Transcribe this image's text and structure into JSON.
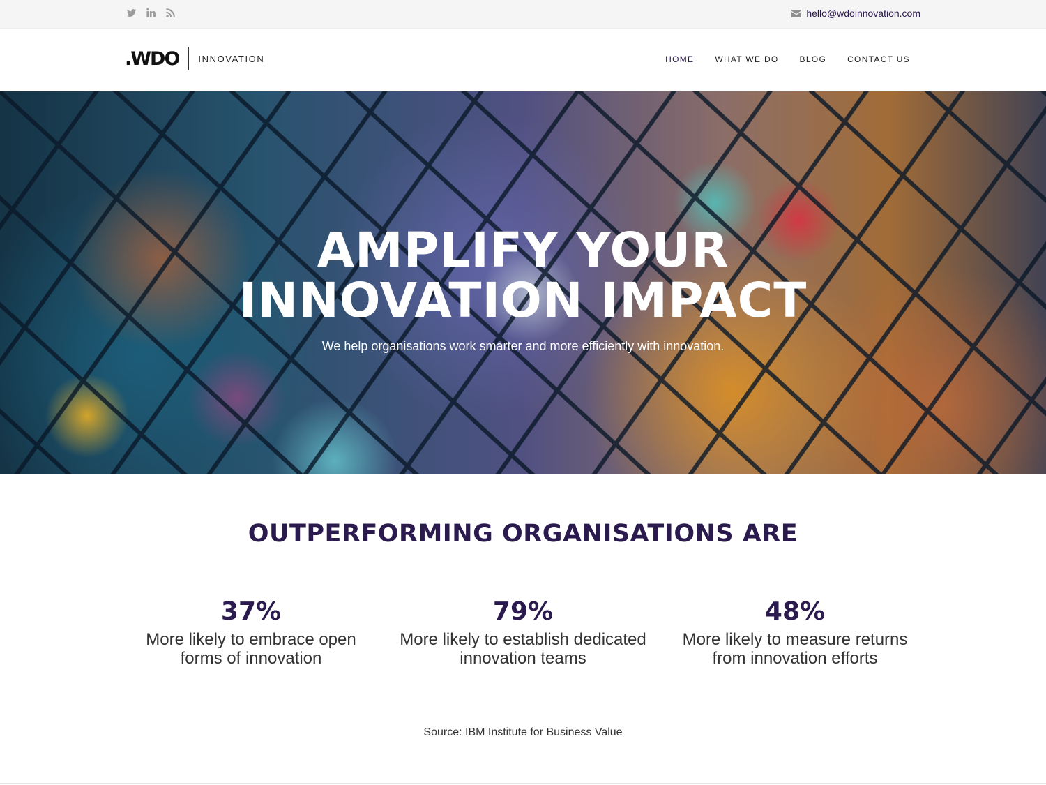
{
  "topbar": {
    "social": [
      {
        "name": "twitter-icon"
      },
      {
        "name": "linkedin-icon"
      },
      {
        "name": "rss-icon"
      }
    ],
    "email": "hello@wdoinnovation.com"
  },
  "header": {
    "logo_mark": ".WDO",
    "logo_sub": "INNOVATION",
    "nav": [
      {
        "label": "HOME",
        "active": true
      },
      {
        "label": "WHAT WE DO",
        "active": false
      },
      {
        "label": "BLOG",
        "active": false
      },
      {
        "label": "CONTACT US",
        "active": false
      }
    ]
  },
  "hero": {
    "title_line1": "AMPLIFY YOUR",
    "title_line2": "INNOVATION IMPACT",
    "subtitle": "We help organisations work smarter and more efficiently with innovation."
  },
  "stats": {
    "heading": "OUTPERFORMING ORGANISATIONS ARE",
    "items": [
      {
        "value": "37%",
        "line1": "More likely to embrace open",
        "line2": "forms of innovation"
      },
      {
        "value": "79%",
        "line1": "More likely to establish dedicated",
        "line2": "innovation teams"
      },
      {
        "value": "48%",
        "line1": "More likely to measure returns",
        "line2": "from innovation efforts"
      }
    ],
    "source": "Source: IBM Institute for Business Value"
  },
  "colors": {
    "brand_purple": "#2b1a4d",
    "topbar_bg": "#f5f5f5",
    "icon_gray": "#9a9a9a"
  }
}
